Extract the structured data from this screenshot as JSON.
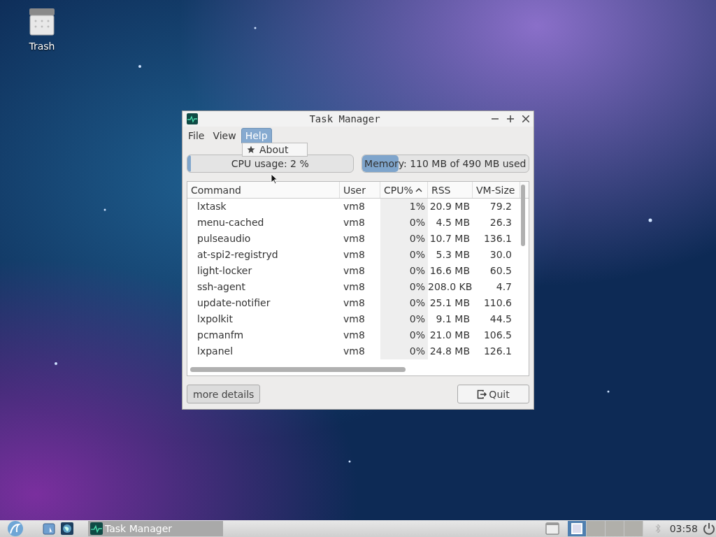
{
  "desktop_icons": [
    {
      "label": "Trash"
    }
  ],
  "window": {
    "title": "Task Manager"
  },
  "menu": [
    {
      "label": "File",
      "selected": false
    },
    {
      "label": "View",
      "selected": false
    },
    {
      "label": "Help",
      "selected": true
    }
  ],
  "dropdown": [
    {
      "label": "About"
    }
  ],
  "meters": [
    {
      "label": "CPU usage: 2 %",
      "level": 0.02
    },
    {
      "label": "Memory: 110 MB of 490 MB used",
      "level": 0.22
    }
  ],
  "table": {
    "columns": [
      {
        "label": "Command",
        "sorted": false
      },
      {
        "label": "User",
        "sorted": false
      },
      {
        "label": "CPU%",
        "sorted": true
      },
      {
        "label": "RSS",
        "sorted": false
      },
      {
        "label": "VM-Size",
        "sorted": false
      }
    ],
    "rows": [
      [
        "lxtask",
        "vm8",
        "1%",
        "20.9 MB",
        "79.2"
      ],
      [
        "menu-cached",
        "vm8",
        "0%",
        "4.5 MB",
        "26.3"
      ],
      [
        "pulseaudio",
        "vm8",
        "0%",
        "10.7 MB",
        "136.1"
      ],
      [
        "at-spi2-registryd",
        "vm8",
        "0%",
        "5.3 MB",
        "30.0"
      ],
      [
        "light-locker",
        "vm8",
        "0%",
        "16.6 MB",
        "60.5"
      ],
      [
        "ssh-agent",
        "vm8",
        "0%",
        "208.0 KB",
        "4.7"
      ],
      [
        "update-notifier",
        "vm8",
        "0%",
        "25.1 MB",
        "110.6"
      ],
      [
        "lxpolkit",
        "vm8",
        "0%",
        "9.1 MB",
        "44.5"
      ],
      [
        "pcmanfm",
        "vm8",
        "0%",
        "21.0 MB",
        "106.5"
      ],
      [
        "lxpanel",
        "vm8",
        "0%",
        "24.8 MB",
        "126.1"
      ]
    ]
  },
  "buttons": [
    {
      "label": "more details",
      "kind": "plain"
    },
    {
      "label": "Quit",
      "kind": "quit"
    }
  ],
  "taskbar": {
    "tasks": [
      {
        "label": "Task Manager"
      }
    ],
    "workspaces": [
      {
        "selected": true
      },
      {
        "selected": false
      },
      {
        "selected": false
      },
      {
        "selected": false
      }
    ],
    "clock": "03:58"
  }
}
